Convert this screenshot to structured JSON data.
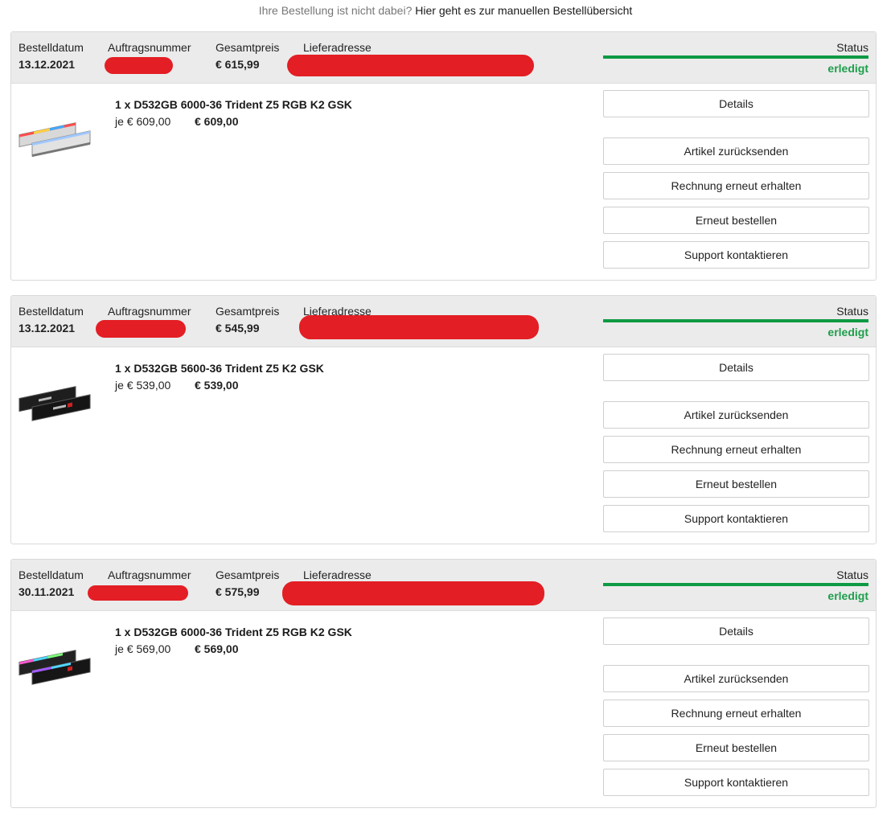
{
  "note": {
    "prefix": "Ihre Bestellung ist nicht dabei?",
    "link": "Hier geht es zur manuellen Bestellübersicht"
  },
  "labels": {
    "date": "Bestelldatum",
    "order_number": "Auftragsnummer",
    "total": "Gesamtpreis",
    "address": "Lieferadresse",
    "status": "Status"
  },
  "buttons": {
    "details": "Details",
    "return": "Artikel zurücksenden",
    "invoice": "Rechnung erneut erhalten",
    "reorder": "Erneut bestellen",
    "support": "Support kontaktieren"
  },
  "orders": [
    {
      "date": "13.12.2021",
      "total": "€ 615,99",
      "status": "erledigt",
      "status_progress": 1.0,
      "item": {
        "name": "1 x D532GB 6000-36 Trident Z5 RGB K2 GSK",
        "unit_price": "je € 609,00",
        "line_total": "€ 609,00",
        "image": "ram-kit-silver-rgb"
      }
    },
    {
      "date": "13.12.2021",
      "total": "€ 545,99",
      "status": "erledigt",
      "status_progress": 1.0,
      "item": {
        "name": "1 x D532GB 5600-36 Trident Z5 K2 GSK",
        "unit_price": "je € 539,00",
        "line_total": "€ 539,00",
        "image": "ram-kit-black"
      }
    },
    {
      "date": "30.11.2021",
      "total": "€ 575,99",
      "status": "erledigt",
      "status_progress": 1.0,
      "item": {
        "name": "1 x D532GB 6000-36 Trident Z5 RGB K2 GSK",
        "unit_price": "je € 569,00",
        "line_total": "€ 569,00",
        "image": "ram-kit-black-rgb"
      }
    }
  ],
  "colors": {
    "status_green": "#0e9a44",
    "redaction": "#e31e24",
    "header_bg": "#ebebeb"
  }
}
